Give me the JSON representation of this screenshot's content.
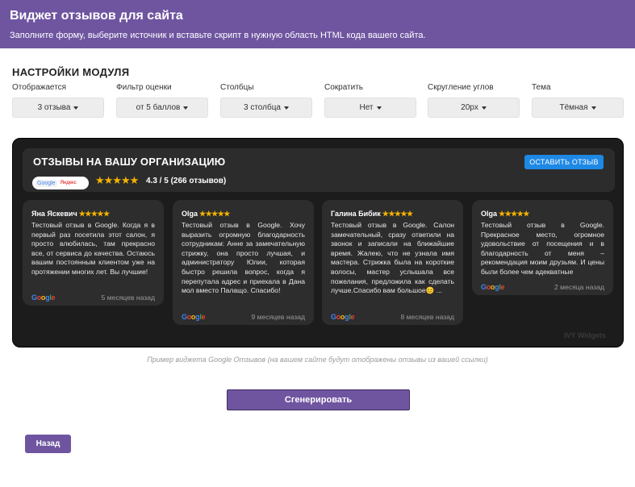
{
  "header": {
    "title": "Виджет отзывов для сайта",
    "subtitle": "Заполните форму, выберите источник и вставьте скрипт в нужную область HTML кода вашего сайта."
  },
  "settings": {
    "title": "НАСТРОЙКИ МОДУЛЯ",
    "fields": [
      {
        "label": "Отображается",
        "value": "3 отзыва"
      },
      {
        "label": "Фильтр оценки",
        "value": "от 5 баллов"
      },
      {
        "label": "Столбцы",
        "value": "3 столбца"
      },
      {
        "label": "Сократить",
        "value": "Нет"
      },
      {
        "label": "Скругление углов",
        "value": "20px"
      },
      {
        "label": "Тема",
        "value": "Тёмная"
      }
    ]
  },
  "widget": {
    "title": "ОТЗЫВЫ НА ВАШУ ОРГАНИЗАЦИЮ",
    "badge_google": "Google",
    "badge_yandex": "Яндекс",
    "stars": "★★★★★",
    "rating_text": "4.3 / 5 (266 отзывов)",
    "leave_button": "ОСТАВИТЬ ОТЗЫВ",
    "watermark": "IVY Widgets",
    "reviews": [
      {
        "author": "Яна Яскевич",
        "stars": "★★★★★",
        "text": "Тестовый отзыв в Google. Когда я в первый раз посетила этот салон, я просто влюбилась, там прекрасно все, от сервиса до качества. Остаюсь вашим постоянным клиентом уже на протяжении многих лет. Вы лучшие!",
        "date": "5 месяцев назад"
      },
      {
        "author": "Olga",
        "stars": "★★★★★",
        "text": "Тестовый отзыв в Google. Хочу выразить огромную благодарность сотрудникам: Анне за замечательную стрижку, она просто лучшая, и администратору Юлии, которая быстро решила вопрос, когда я перепутала адрес и приехала в Дана мол вместо Палащо. Спасибо!",
        "date": "9 месяцев назад"
      },
      {
        "author": "Галина Бибик",
        "stars": "★★★★★",
        "text": "Тестовый отзыв в Google. Салон замечательный, сразу ответили на звонок и записали на ближайшие время. Жалею, что не узнала имя мастера. Стрижка была на короткие волосы, мастер услышала все пожелания, предложила как сделать лучше.Спасибо вам большое😊 ...",
        "date": "8 месяцев назад"
      },
      {
        "author": "Olga",
        "stars": "★★★★★",
        "text": "Тестовый отзыв в Google. Прекрасное место, огромное удовольствие от посещения и в благодарность от меня – рекомендация моим друзьям. И цены были более чем адекватные",
        "date": "2 месяца назад"
      }
    ]
  },
  "caption": "Пример виджета Google Отзывов (на вашем сайте будут отображены отзывы из вашей ссылки)",
  "generate_button": "Сгенерировать",
  "back_button": "Назад"
}
